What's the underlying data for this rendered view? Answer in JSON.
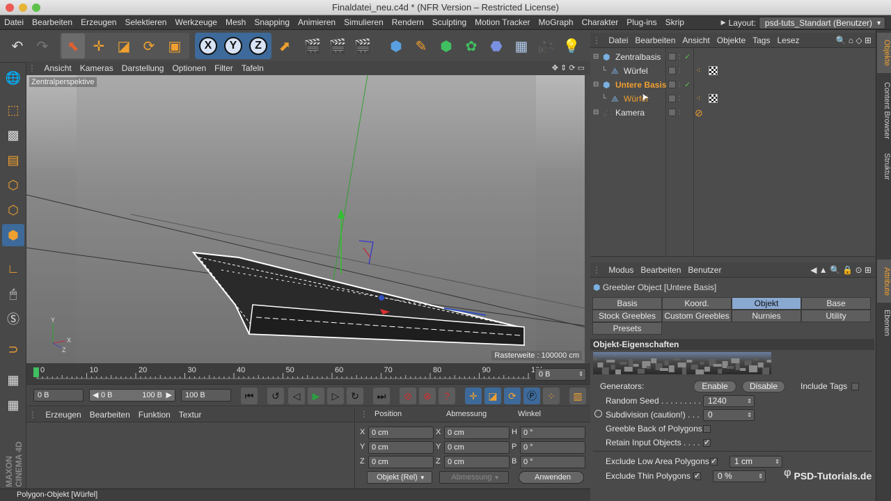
{
  "window": {
    "title": "Finaldatei_neu.c4d * (NFR Version – Restricted License)"
  },
  "menubar": {
    "items": [
      "Datei",
      "Bearbeiten",
      "Erzeugen",
      "Selektieren",
      "Werkzeuge",
      "Mesh",
      "Snapping",
      "Animieren",
      "Simulieren",
      "Rendern",
      "Sculpting",
      "Motion Tracker",
      "MoGraph",
      "Charakter",
      "Plug-ins",
      "Skrip"
    ],
    "layout_label": "Layout:",
    "layout_value": "psd-tuts_Standart (Benutzer)"
  },
  "viewport": {
    "menu": [
      "Ansicht",
      "Kameras",
      "Darstellung",
      "Optionen",
      "Filter",
      "Tafeln"
    ],
    "camera_label": "Zentralperspektive",
    "raster": "Rasterweite : 100000 cm"
  },
  "timeline": {
    "ticks": [
      "0",
      "10",
      "20",
      "30",
      "40",
      "50",
      "60",
      "70",
      "80",
      "90",
      "10("
    ],
    "current_frame": "0 B"
  },
  "transport": {
    "start": "0 B",
    "range_start": "0 B",
    "range_end": "100 B",
    "end": "100 B"
  },
  "material_panel": {
    "menu": [
      "Erzeugen",
      "Bearbeiten",
      "Funktion",
      "Textur"
    ]
  },
  "coord_panel": {
    "headers": [
      "Position",
      "Abmessung",
      "Winkel"
    ],
    "rows": [
      {
        "axis": "X",
        "pos": "0 cm",
        "size_axis": "X",
        "size": "0 cm",
        "rot_axis": "H",
        "rot": "0 °"
      },
      {
        "axis": "Y",
        "pos": "0 cm",
        "size_axis": "Y",
        "size": "0 cm",
        "rot_axis": "P",
        "rot": "0 °"
      },
      {
        "axis": "Z",
        "pos": "0 cm",
        "size_axis": "Z",
        "size": "0 cm",
        "rot_axis": "B",
        "rot": "0 °"
      }
    ],
    "mode": "Objekt (Rel)",
    "size_mode": "Abmessung",
    "apply": "Anwenden"
  },
  "status": "Polygon-Objekt [Würfel]",
  "brand": "MAXON CINEMA 4D",
  "object_manager": {
    "menu": [
      "Datei",
      "Bearbeiten",
      "Ansicht",
      "Objekte",
      "Tags",
      "Lesez"
    ],
    "objects": [
      {
        "name": "Zentralbasis",
        "indent": 0,
        "selected": false
      },
      {
        "name": "Würfel",
        "indent": 1,
        "selected": false
      },
      {
        "name": "Untere Basis",
        "indent": 0,
        "selected": true
      },
      {
        "name": "Würfel",
        "indent": 1,
        "selected": true
      },
      {
        "name": "Kamera",
        "indent": 0,
        "selected": false
      }
    ]
  },
  "right_tabs": [
    "Objekte",
    "Content Browser",
    "Struktur",
    "Attribute",
    "Ebenen"
  ],
  "attribute_manager": {
    "menu": [
      "Modus",
      "Bearbeiten",
      "Benutzer"
    ],
    "object_title": "Greebler Object [Untere Basis]",
    "tabs": [
      "Basis",
      "Koord.",
      "Objekt",
      "Base",
      "Stock Greebles",
      "Custom Greebles",
      "Nurnies",
      "Utility",
      "Presets"
    ],
    "active_tab": "Objekt",
    "section": "Objekt-Eigenschaften",
    "generators_label": "Generators:",
    "enable": "Enable",
    "disable": "Disable",
    "include_tags": "Include Tags",
    "random_seed_label": "Random Seed . . . . . . . . . .",
    "random_seed": "1240",
    "subdivision_label": "Subdivision (caution!) . . .",
    "subdivision": "0",
    "greeble_back": "Greeble Back of Polygons",
    "retain_input": "Retain Input Objects . . . .",
    "exclude_low": "Exclude Low Area Polygons",
    "exclude_low_value": "1 cm",
    "exclude_thin": "Exclude Thin Polygons",
    "exclude_thin_value": "0 %"
  },
  "watermark": "PSD-Tutorials.de",
  "colors": {
    "accent": "#f0a030",
    "active_tab": "#8aa9d1",
    "selected_text": "#f0a030"
  }
}
